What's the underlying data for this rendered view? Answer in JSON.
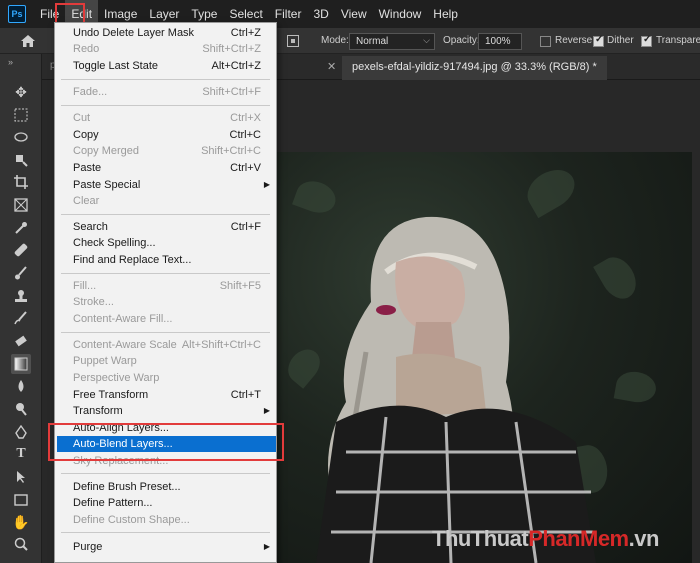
{
  "app": {
    "logo_text": "Ps"
  },
  "menubar": {
    "items": [
      "File",
      "Edit",
      "Image",
      "Layer",
      "Type",
      "Select",
      "Filter",
      "3D",
      "View",
      "Window",
      "Help"
    ]
  },
  "options": {
    "mode_label": "Mode:",
    "mode_value": "Normal",
    "opacity_label": "Opacity:",
    "opacity_value": "100%",
    "reverse_label": "Reverse",
    "dither_label": "Dither",
    "transparency_label": "Transparer"
  },
  "tabs": {
    "left_partial": "pe",
    "active_title": "pexels-efdal-yildiz-917494.jpg @ 33.3% (RGB/8) *"
  },
  "edit_menu": {
    "undo": {
      "label": "Undo Delete Layer Mask",
      "shortcut": "Ctrl+Z"
    },
    "redo": {
      "label": "Redo",
      "shortcut": "Shift+Ctrl+Z"
    },
    "toggle_last": {
      "label": "Toggle Last State",
      "shortcut": "Alt+Ctrl+Z"
    },
    "fade": {
      "label": "Fade...",
      "shortcut": "Shift+Ctrl+F"
    },
    "cut": {
      "label": "Cut",
      "shortcut": "Ctrl+X"
    },
    "copy": {
      "label": "Copy",
      "shortcut": "Ctrl+C"
    },
    "copy_merged": {
      "label": "Copy Merged",
      "shortcut": "Shift+Ctrl+C"
    },
    "paste": {
      "label": "Paste",
      "shortcut": "Ctrl+V"
    },
    "paste_special": {
      "label": "Paste Special"
    },
    "clear": {
      "label": "Clear"
    },
    "search": {
      "label": "Search",
      "shortcut": "Ctrl+F"
    },
    "check_spelling": {
      "label": "Check Spelling..."
    },
    "find_replace": {
      "label": "Find and Replace Text..."
    },
    "fill": {
      "label": "Fill...",
      "shortcut": "Shift+F5"
    },
    "stroke": {
      "label": "Stroke..."
    },
    "content_aware_fill": {
      "label": "Content-Aware Fill..."
    },
    "content_aware_scale": {
      "label": "Content-Aware Scale",
      "shortcut": "Alt+Shift+Ctrl+C"
    },
    "puppet_warp": {
      "label": "Puppet Warp"
    },
    "perspective_warp": {
      "label": "Perspective Warp"
    },
    "free_transform": {
      "label": "Free Transform",
      "shortcut": "Ctrl+T"
    },
    "transform": {
      "label": "Transform"
    },
    "auto_align": {
      "label": "Auto-Align Layers..."
    },
    "auto_blend": {
      "label": "Auto-Blend Layers..."
    },
    "sky_replacement": {
      "label": "Sky Replacement..."
    },
    "define_brush": {
      "label": "Define Brush Preset..."
    },
    "define_pattern": {
      "label": "Define Pattern..."
    },
    "define_shape": {
      "label": "Define Custom Shape..."
    },
    "purge": {
      "label": "Purge"
    }
  },
  "watermark": {
    "part1": "ThuThuat",
    "part2": "PhanMem",
    "part3": ".vn"
  },
  "colors": {
    "highlight": "#0a6fd0",
    "annotation": "#e23b3b"
  }
}
